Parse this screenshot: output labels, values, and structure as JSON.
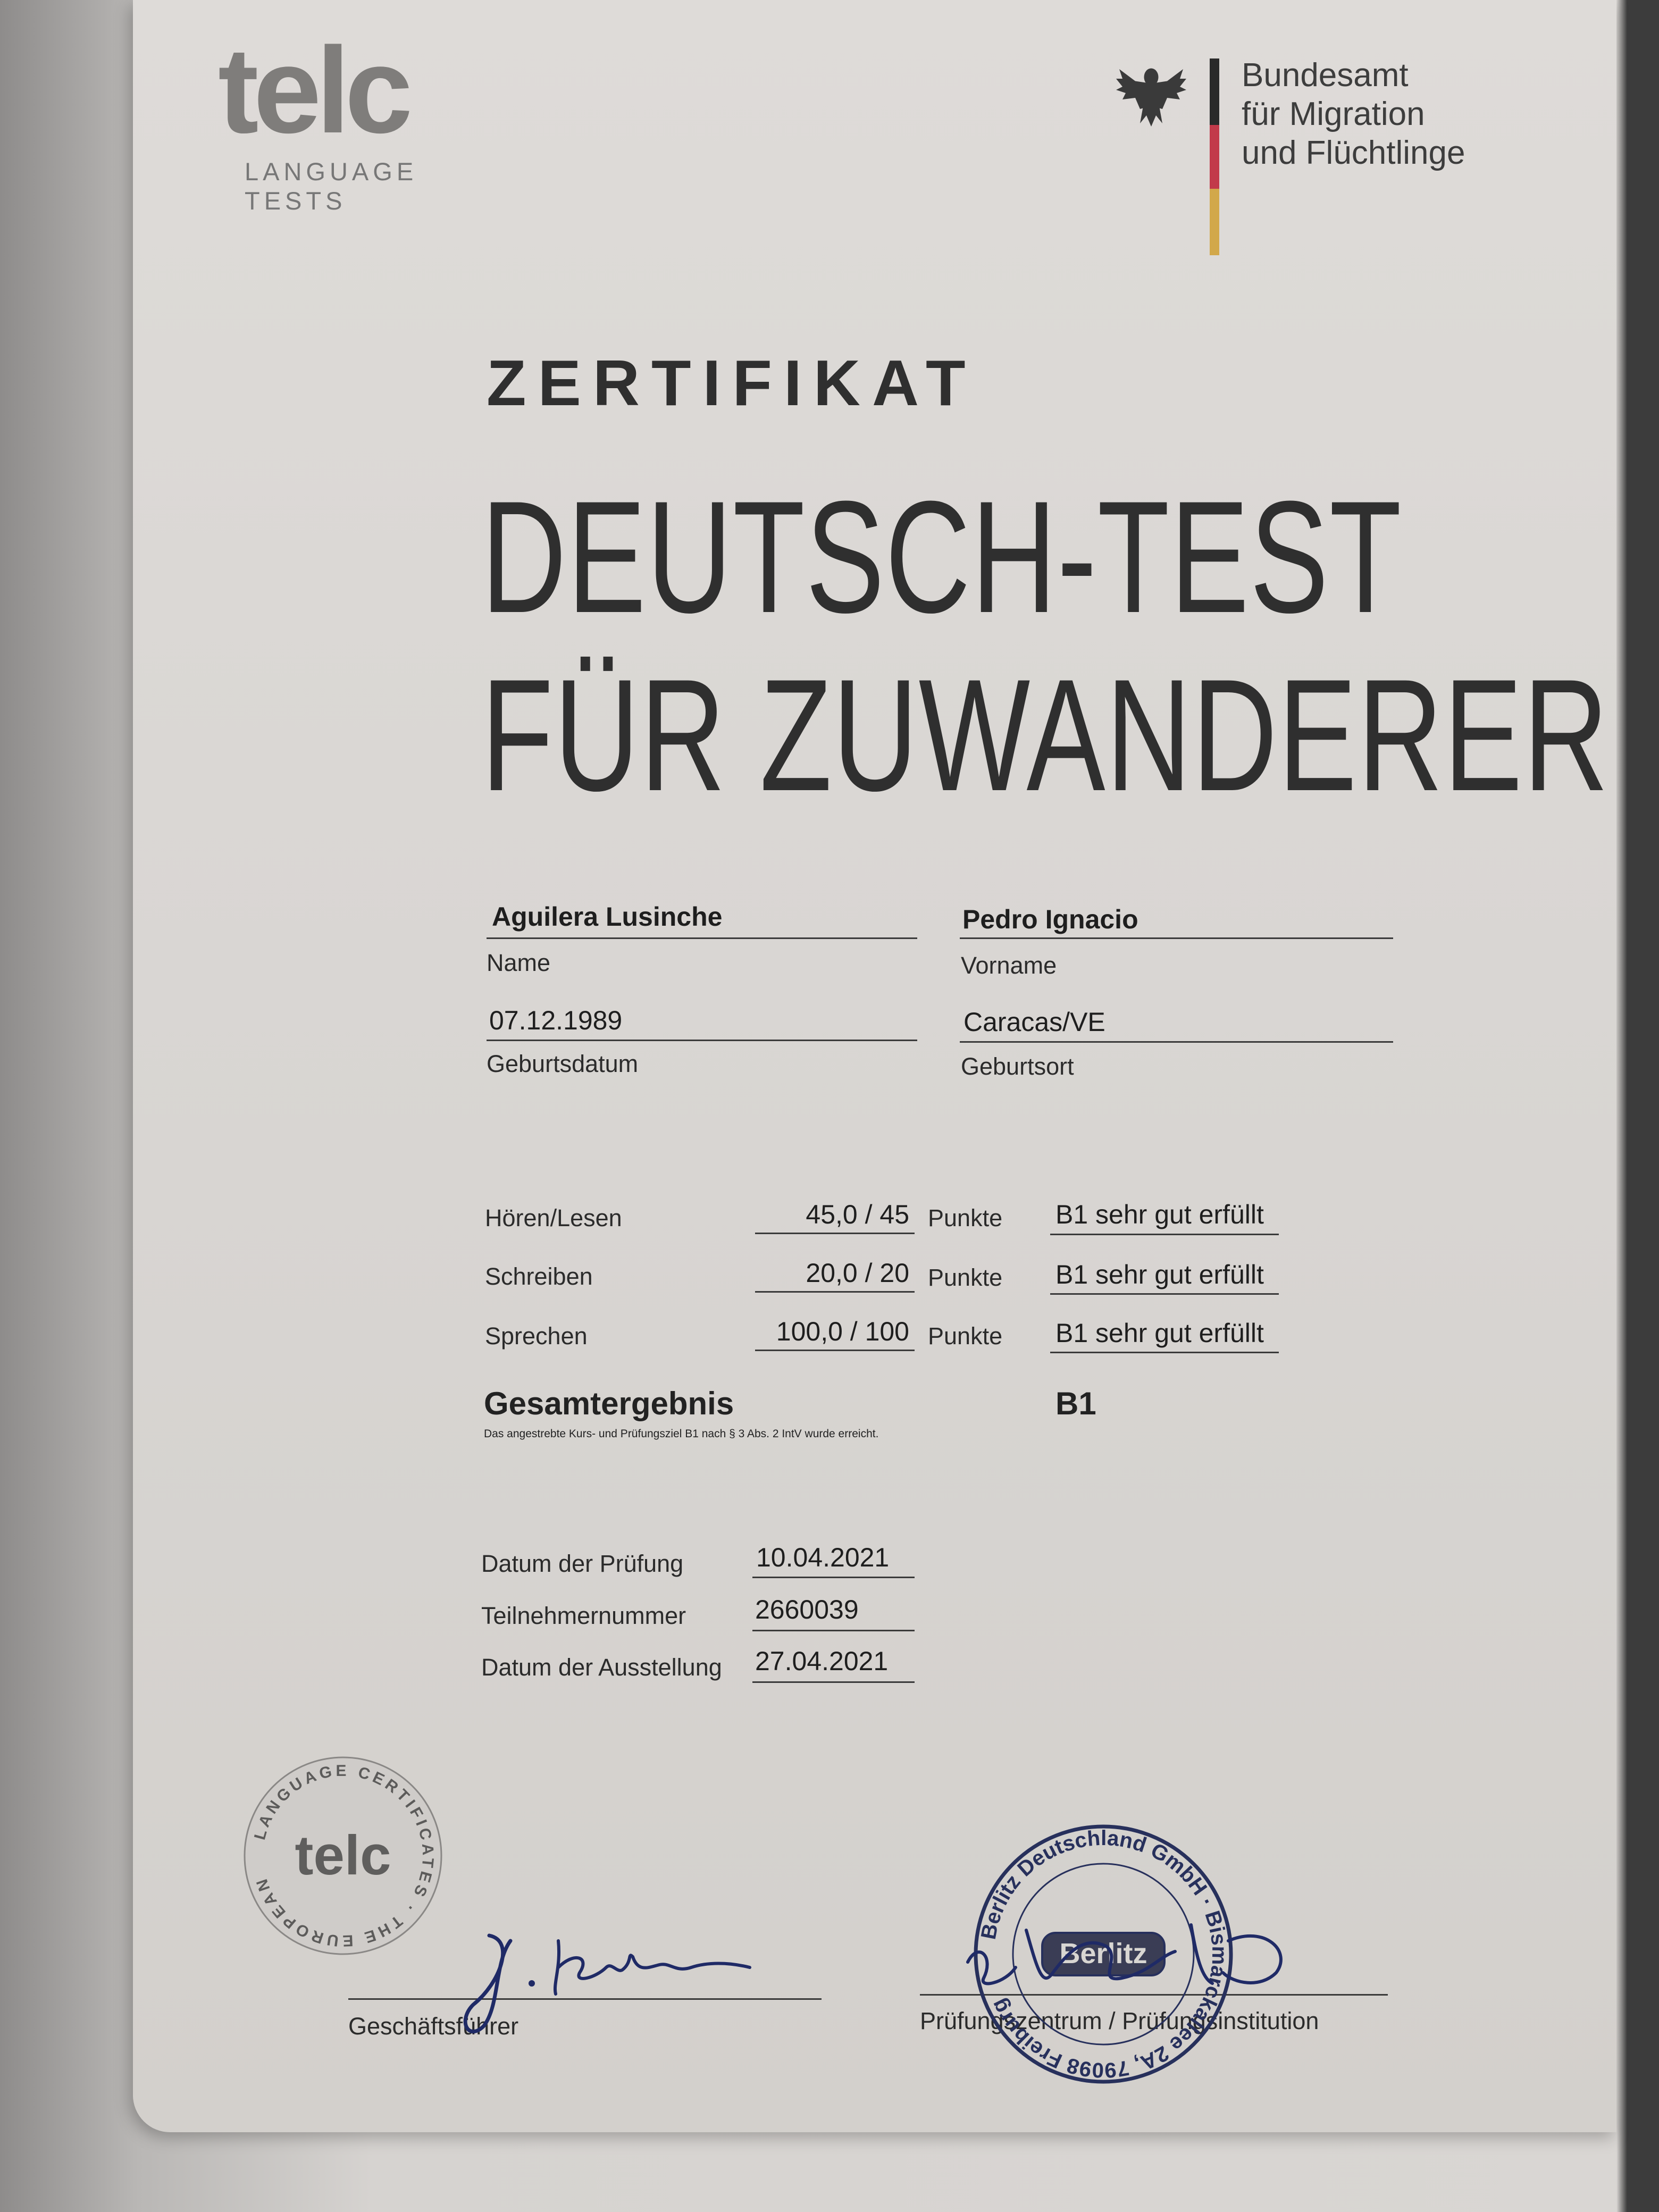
{
  "header": {
    "telc_logo": "telc",
    "telc_subtitle": "LANGUAGE TESTS",
    "bamf_line1": "Bundesamt",
    "bamf_line2": "für Migration",
    "bamf_line3": "und Flüchtlinge"
  },
  "title": {
    "kicker": "ZERTIFIKAT",
    "line1": "DEUTSCH-TEST",
    "line2": "FÜR ZUWANDERER"
  },
  "person": {
    "name_value": "Aguilera Lusinche",
    "name_label": "Name",
    "vorname_value": "Pedro Ignacio",
    "vorname_label": "Vorname",
    "geburtsdatum_value": "07.12.1989",
    "geburtsdatum_label": "Geburtsdatum",
    "geburtsort_value": "Caracas/VE",
    "geburtsort_label": "Geburtsort"
  },
  "results": {
    "rows": [
      {
        "label": "Hören/Lesen",
        "score": "45,0 / 45",
        "unit": "Punkte",
        "grade": "B1 sehr gut erfüllt"
      },
      {
        "label": "Schreiben",
        "score": "20,0 / 20",
        "unit": "Punkte",
        "grade": "B1 sehr gut erfüllt"
      },
      {
        "label": "Sprechen",
        "score": "100,0 / 100",
        "unit": "Punkte",
        "grade": "B1 sehr gut erfüllt"
      }
    ],
    "total_label": "Gesamtergebnis",
    "total_value": "B1",
    "note": "Das angestrebte Kurs- und Prüfungsziel B1 nach § 3 Abs. 2 IntV wurde erreicht."
  },
  "exam": {
    "datum_label": "Datum der Prüfung",
    "datum_value": "10.04.2021",
    "nummer_label": "Teilnehmernummer",
    "nummer_value": "2660039",
    "ausstellung_label": "Datum der Ausstellung",
    "ausstellung_value": "27.04.2021"
  },
  "footer": {
    "seal_ring_text": "LANGUAGE CERTIFICATES · THE EUROPEAN",
    "seal_center": "telc",
    "left_sign_label": "Geschäftsführer",
    "right_sign_label": "Prüfungszentrum / Prüfungsinstitution",
    "stamp_ring_text": "Berlitz Deutschland GmbH · Bismarckallee 2A, 79098 Freiburg",
    "stamp_center": "Berlitz"
  },
  "colors": {
    "paper": "#dbd8d5",
    "ink": "#2f2f2f",
    "flag_black": "#2a2a2a",
    "flag_red": "#c23a4a",
    "flag_gold": "#d2a84a",
    "stamp_blue": "#27305c"
  }
}
